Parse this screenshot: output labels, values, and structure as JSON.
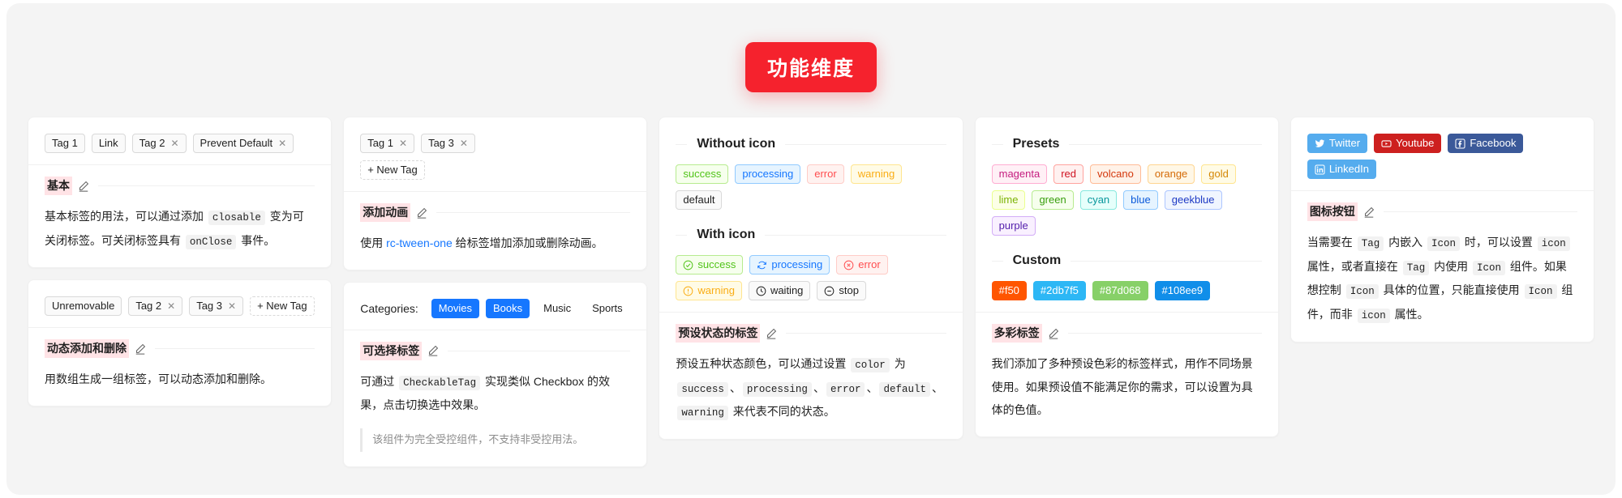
{
  "page": {
    "title": "功能维度",
    "accent": "#f5222d"
  },
  "col1": {
    "card1": {
      "tags": [
        {
          "label": "Tag 1",
          "closable": false
        },
        {
          "label": "Link",
          "closable": false
        },
        {
          "label": "Tag 2",
          "closable": true
        },
        {
          "label": "Prevent Default",
          "closable": true
        }
      ],
      "meta_title": "基本",
      "desc_parts": [
        "基本标签的用法，可以通过添加 ",
        "closable",
        " 变为可关闭标签。可关闭标签具有 ",
        "onClose",
        " 事件。"
      ]
    },
    "card2": {
      "tags": [
        {
          "label": "Unremovable",
          "closable": false
        },
        {
          "label": "Tag 2",
          "closable": true
        },
        {
          "label": "Tag 3",
          "closable": true
        }
      ],
      "new_tag": "+ New Tag",
      "meta_title": "动态添加和删除",
      "desc": "用数组生成一组标签，可以动态添加和删除。"
    }
  },
  "col2": {
    "card1": {
      "tags": [
        {
          "label": "Tag 1",
          "closable": true
        },
        {
          "label": "Tag 3",
          "closable": true
        }
      ],
      "new_tag": "+ New Tag",
      "meta_title": "添加动画",
      "desc_pre": "使用 ",
      "desc_link": "rc-tween-one",
      "desc_post": " 给标签增加添加或删除动画。"
    },
    "card2": {
      "label": "Categories:",
      "tags": [
        {
          "label": "Movies",
          "checked": true
        },
        {
          "label": "Books",
          "checked": true
        },
        {
          "label": "Music",
          "checked": false
        },
        {
          "label": "Sports",
          "checked": false
        }
      ],
      "meta_title": "可选择标签",
      "desc_parts": [
        "可通过 ",
        "CheckableTag",
        " 实现类似 Checkbox 的效果，点击切换选中效果。"
      ],
      "quote": "该组件为完全受控组件，不支持非受控用法。"
    }
  },
  "col3": {
    "divider_without": "Without icon",
    "tags_without": [
      {
        "label": "success",
        "color": "#52c41a",
        "bg": "#f6ffed",
        "border": "#b7eb8f"
      },
      {
        "label": "processing",
        "color": "#1677ff",
        "bg": "#e6f4ff",
        "border": "#91caff"
      },
      {
        "label": "error",
        "color": "#ff4d4f",
        "bg": "#fff2f0",
        "border": "#ffccc7"
      },
      {
        "label": "warning",
        "color": "#faad14",
        "bg": "#fffbe6",
        "border": "#ffe58f"
      },
      {
        "label": "default",
        "color": "#1f1f1f",
        "bg": "#fafafa",
        "border": "#d9d9d9"
      }
    ],
    "divider_with": "With icon",
    "tags_with": [
      {
        "label": "success",
        "icon": "check-circle-icon",
        "color": "#52c41a",
        "bg": "#f6ffed",
        "border": "#b7eb8f"
      },
      {
        "label": "processing",
        "icon": "sync-icon",
        "color": "#1677ff",
        "bg": "#e6f4ff",
        "border": "#91caff"
      },
      {
        "label": "error",
        "icon": "close-circle-icon",
        "color": "#ff4d4f",
        "bg": "#fff2f0",
        "border": "#ffccc7"
      },
      {
        "label": "warning",
        "icon": "exclamation-circle-icon",
        "color": "#faad14",
        "bg": "#fffbe6",
        "border": "#ffe58f"
      },
      {
        "label": "waiting",
        "icon": "clock-circle-icon",
        "color": "#1f1f1f",
        "bg": "#fafafa",
        "border": "#d9d9d9"
      },
      {
        "label": "stop",
        "icon": "minus-circle-icon",
        "color": "#1f1f1f",
        "bg": "#fafafa",
        "border": "#d9d9d9"
      }
    ],
    "meta_title": "预设状态的标签",
    "desc_parts": [
      "预设五种状态颜色，可以通过设置 ",
      "color",
      " 为 ",
      "success",
      "、",
      "processing",
      "、",
      "error",
      "、",
      "default",
      "、",
      "warning",
      " 来代表不同的状态。"
    ]
  },
  "col4": {
    "divider_presets": "Presets",
    "presets": [
      {
        "label": "magenta",
        "color": "#c41d7f",
        "bg": "#fff0f6",
        "border": "#ffadd2"
      },
      {
        "label": "red",
        "color": "#cf1322",
        "bg": "#fff1f0",
        "border": "#ffa39e"
      },
      {
        "label": "volcano",
        "color": "#d4380d",
        "bg": "#fff2e8",
        "border": "#ffbb96"
      },
      {
        "label": "orange",
        "color": "#d46b08",
        "bg": "#fff7e6",
        "border": "#ffd591"
      },
      {
        "label": "gold",
        "color": "#d48806",
        "bg": "#fffbe6",
        "border": "#ffe58f"
      },
      {
        "label": "lime",
        "color": "#7cb305",
        "bg": "#fcffe6",
        "border": "#eaff8f"
      },
      {
        "label": "green",
        "color": "#389e0d",
        "bg": "#f6ffed",
        "border": "#b7eb8f"
      },
      {
        "label": "cyan",
        "color": "#08979c",
        "bg": "#e6fffb",
        "border": "#87e8de"
      },
      {
        "label": "blue",
        "color": "#0958d9",
        "bg": "#e6f4ff",
        "border": "#91caff"
      },
      {
        "label": "geekblue",
        "color": "#1d39c4",
        "bg": "#f0f5ff",
        "border": "#adc6ff"
      },
      {
        "label": "purple",
        "color": "#531dab",
        "bg": "#f9f0ff",
        "border": "#d3adf7"
      }
    ],
    "divider_custom": "Custom",
    "customs": [
      {
        "label": "#f50",
        "bg": "#f50"
      },
      {
        "label": "#2db7f5",
        "bg": "#2db7f5"
      },
      {
        "label": "#87d068",
        "bg": "#87d068"
      },
      {
        "label": "#108ee9",
        "bg": "#108ee9"
      }
    ],
    "meta_title": "多彩标签",
    "desc": "我们添加了多种预设色彩的标签样式，用作不同场景使用。如果预设值不能满足你的需求，可以设置为具体的色值。"
  },
  "col5": {
    "socials": [
      {
        "label": "Twitter",
        "icon": "twitter-icon",
        "bg": "#55acee"
      },
      {
        "label": "Youtube",
        "icon": "youtube-icon",
        "bg": "#cd201f"
      },
      {
        "label": "Facebook",
        "icon": "facebook-icon",
        "bg": "#3b5999"
      },
      {
        "label": "LinkedIn",
        "icon": "linkedin-icon",
        "bg": "#55acee"
      }
    ],
    "meta_title": "图标按钮",
    "desc_parts": [
      "当需要在 ",
      "Tag",
      " 内嵌入 ",
      "Icon",
      " 时，可以设置 ",
      "icon",
      " 属性，或者直接在 ",
      "Tag",
      " 内使用 ",
      "Icon",
      " 组件。如果想控制 ",
      "Icon",
      " 具体的位置，只能直接使用 ",
      "Icon",
      " 组件，而非 ",
      "icon",
      " 属性。"
    ]
  }
}
